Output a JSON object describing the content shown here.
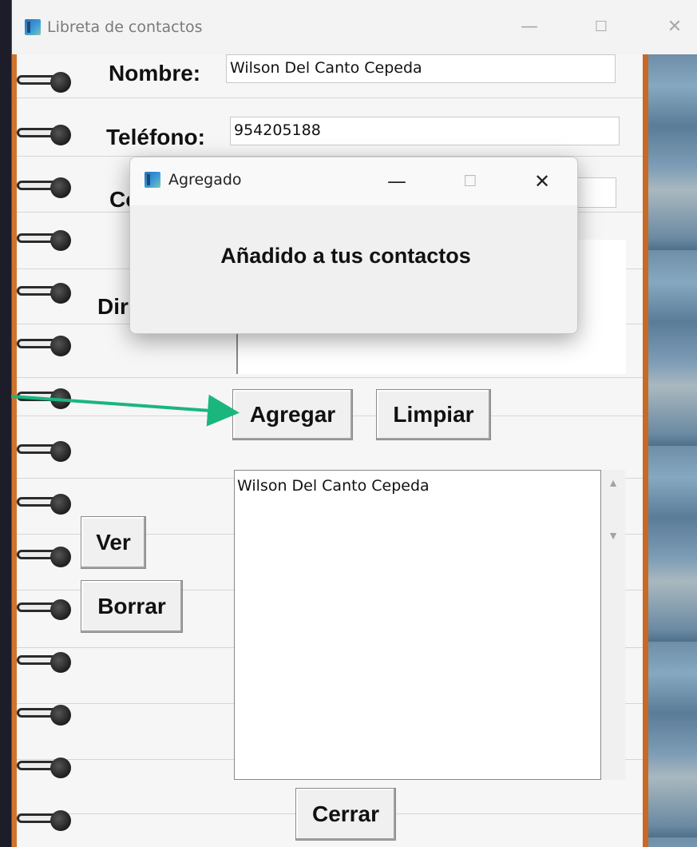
{
  "window": {
    "title": "Libreta de contactos",
    "minimize_glyph": "—",
    "maximize_glyph": "☐",
    "close_glyph": "✕"
  },
  "form": {
    "nombre_label": "Nombre:",
    "nombre_value": "Wilson Del Canto Cepeda",
    "telefono_label": "Teléfono:",
    "telefono_value": "954205188",
    "correo_label_partial": "Co",
    "direccion_label_partial": "Dir"
  },
  "buttons": {
    "agregar": "Agregar",
    "limpiar": "Limpiar",
    "ver": "Ver",
    "borrar": "Borrar",
    "cerrar": "Cerrar"
  },
  "contacts_list": [
    "Wilson Del Canto Cepeda"
  ],
  "dialog": {
    "title": "Agregado",
    "message": "Añadido a tus contactos",
    "minimize_glyph": "—",
    "maximize_glyph": "☐",
    "close_glyph": "✕"
  },
  "colors": {
    "annotation_arrow": "#19b67e",
    "spine": "#d2732c",
    "app_icon": "#2a6fb5"
  }
}
